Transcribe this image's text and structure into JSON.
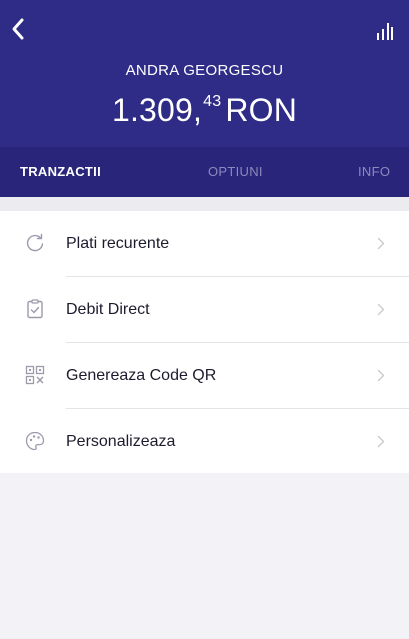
{
  "header": {
    "owner_name": "ANDRA GEORGESCU",
    "balance_integer": "1.309,",
    "balance_decimals": "43",
    "balance_currency": "RON",
    "back_icon": "chevron-left-icon",
    "stats_icon": "bar-chart-icon",
    "background_color": "#2f2c87"
  },
  "tabs": [
    {
      "label": "TRANZACTII",
      "active": true
    },
    {
      "label": "OPTIUNI",
      "active": false
    },
    {
      "label": "INFO",
      "active": false
    }
  ],
  "menu": {
    "items": [
      {
        "label": "Plati recurente",
        "icon": "refresh-icon"
      },
      {
        "label": "Debit Direct",
        "icon": "clipboard-check-icon"
      },
      {
        "label": "Genereaza Code QR",
        "icon": "qr-code-icon"
      },
      {
        "label": "Personalizeaza",
        "icon": "palette-icon"
      }
    ],
    "chevron_icon": "chevron-right-icon"
  }
}
